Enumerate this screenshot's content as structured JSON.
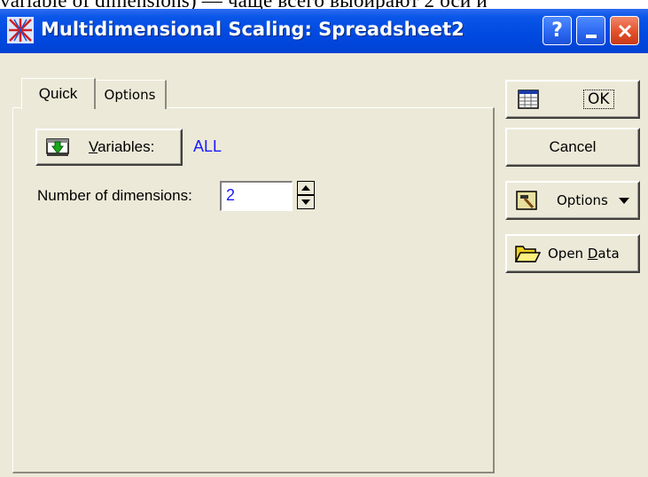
{
  "document": {
    "cropped_line": "variable of dimensions) — чаще всего выбирают 2 оси и"
  },
  "window": {
    "title": "Multidimensional Scaling: Spreadsheet2",
    "icon": "mds-app-icon",
    "help_label": "?",
    "close_label": "X"
  },
  "tabs": [
    {
      "label": "Quick",
      "active": true
    },
    {
      "label": "Options",
      "active": false
    }
  ],
  "quick": {
    "variables_button": {
      "label_underlined": "V",
      "label_rest": "ariables:",
      "icon": "variables-icon"
    },
    "variables_value": "ALL",
    "dimensions_label": "Number of dimensions:",
    "dimensions_value": "2"
  },
  "side_buttons": {
    "ok": {
      "label": "OK",
      "icon": "spreadsheet-icon"
    },
    "cancel": {
      "label": "Cancel"
    },
    "options": {
      "label": "Options",
      "icon": "hammer-icon"
    },
    "open_data": {
      "label_pre": "Open ",
      "label_underlined": "D",
      "label_post": "ata",
      "icon": "folder-open-icon"
    }
  },
  "colors": {
    "title_bar": "#0049e0",
    "dialog_bg": "#ece9d8",
    "value_text": "#1a1aff",
    "close_button": "#e4502a"
  }
}
